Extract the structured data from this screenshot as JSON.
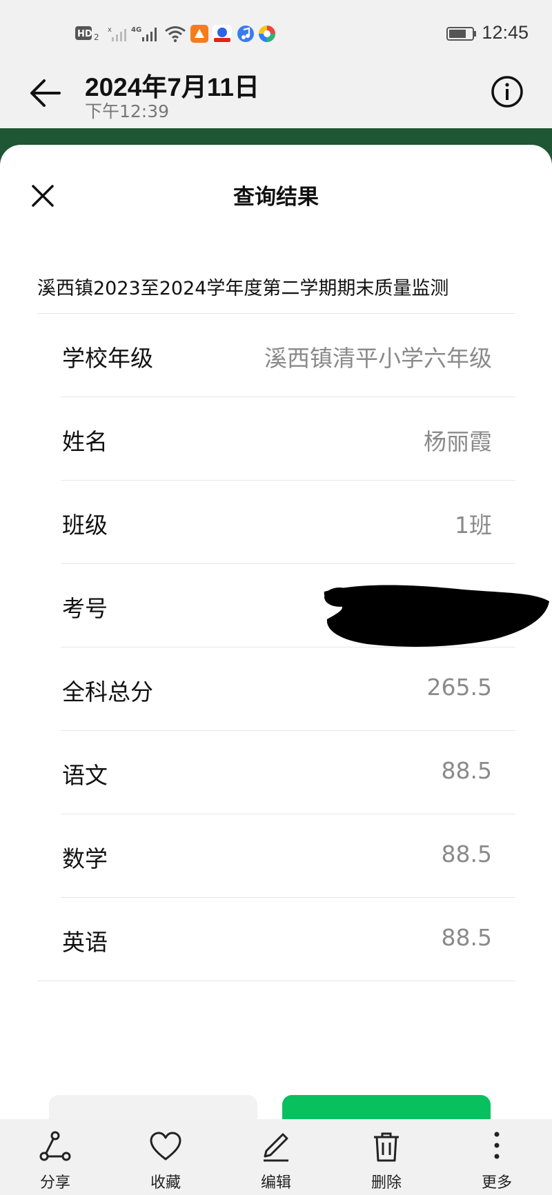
{
  "status_bar": {
    "time": "12:45",
    "icons": [
      "hd-2-icon",
      "signal-1-icon",
      "signal-4g-icon",
      "wifi-icon",
      "app-icon-orange",
      "baidu-icon",
      "music-icon",
      "app-icon-colorful",
      "battery-icon"
    ]
  },
  "header": {
    "title": "2024年7月11日",
    "subtitle": "下午12:39",
    "back_icon": "arrow-left-icon",
    "info_icon": "info-icon"
  },
  "sheet": {
    "title": "查询结果",
    "close_icon": "close-icon",
    "exam_name": "溪西镇2023至2024学年度第二学期期末质量监测",
    "rows": [
      {
        "label": "学校年级",
        "value": "溪西镇清平小学六年级"
      },
      {
        "label": "姓名",
        "value": "杨丽霞"
      },
      {
        "label": "班级",
        "value": "1班"
      },
      {
        "label": "考号",
        "value": ""
      },
      {
        "label": "全科总分",
        "value": "265.5"
      },
      {
        "label": "语文",
        "value": "88.5"
      },
      {
        "label": "数学",
        "value": "88.5"
      },
      {
        "label": "英语",
        "value": "88.5"
      }
    ]
  },
  "colors": {
    "accent_green": "#09c05e",
    "header_band": "#1f5633"
  },
  "toolbar": {
    "items": [
      {
        "label": "分享",
        "icon": "share-icon"
      },
      {
        "label": "收藏",
        "icon": "heart-icon"
      },
      {
        "label": "编辑",
        "icon": "pencil-icon"
      },
      {
        "label": "删除",
        "icon": "trash-icon"
      },
      {
        "label": "更多",
        "icon": "more-vertical-icon"
      }
    ]
  }
}
